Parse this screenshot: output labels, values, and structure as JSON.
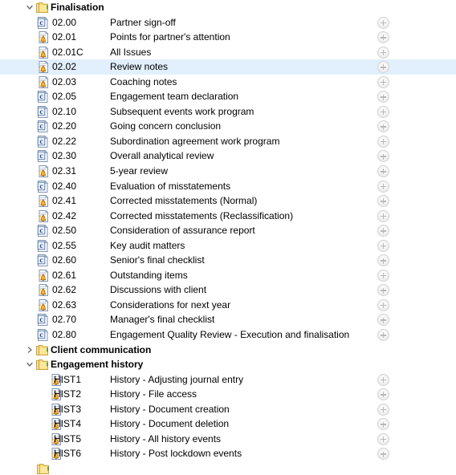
{
  "view": {
    "type": "file-tree",
    "selected_row_code": "02.02",
    "colors": {
      "selection": "#e2effc",
      "folder": "#ffd675",
      "doc_c_letter": "#1f4e9c",
      "doc_bell": "#f0a82a",
      "text": "#000000",
      "plus_button_border": "#d2d2d2"
    }
  },
  "rows": [
    {
      "kind": "folder",
      "indent": 1,
      "expanded": true,
      "label": "Finalisation"
    },
    {
      "kind": "file",
      "indent": 2,
      "icon": "document-c-icon",
      "code": "02.00",
      "desc": "Partner sign-off",
      "add": true
    },
    {
      "kind": "file",
      "indent": 2,
      "icon": "document-bell-icon",
      "code": "02.01",
      "desc": "Points for partner's attention",
      "add": true
    },
    {
      "kind": "file",
      "indent": 2,
      "icon": "document-bell-icon",
      "code": "02.01C",
      "desc": "All Issues",
      "add": true
    },
    {
      "kind": "file",
      "indent": 2,
      "icon": "document-bell-icon",
      "code": "02.02",
      "desc": "Review notes",
      "add": true,
      "selected": true
    },
    {
      "kind": "file",
      "indent": 2,
      "icon": "document-bell-icon",
      "code": "02.03",
      "desc": "Coaching notes",
      "add": true
    },
    {
      "kind": "file",
      "indent": 2,
      "icon": "document-c-icon",
      "code": "02.05",
      "desc": "Engagement team declaration",
      "add": true
    },
    {
      "kind": "file",
      "indent": 2,
      "icon": "document-c-icon",
      "code": "02.10",
      "desc": "Subsequent events work program",
      "add": true
    },
    {
      "kind": "file",
      "indent": 2,
      "icon": "document-c-icon",
      "code": "02.20",
      "desc": "Going concern conclusion",
      "add": true
    },
    {
      "kind": "file",
      "indent": 2,
      "icon": "document-c-icon",
      "code": "02.22",
      "desc": "Subordination agreement work program",
      "add": true
    },
    {
      "kind": "file",
      "indent": 2,
      "icon": "document-c-icon",
      "code": "02.30",
      "desc": "Overall analytical review",
      "add": true
    },
    {
      "kind": "file",
      "indent": 2,
      "icon": "document-bell-icon",
      "code": "02.31",
      "desc": "5-year review",
      "add": true
    },
    {
      "kind": "file",
      "indent": 2,
      "icon": "document-c-icon",
      "code": "02.40",
      "desc": "Evaluation of misstatements",
      "add": true
    },
    {
      "kind": "file",
      "indent": 2,
      "icon": "document-bell-icon",
      "code": "02.41",
      "desc": "Corrected misstatements (Normal)",
      "add": true
    },
    {
      "kind": "file",
      "indent": 2,
      "icon": "document-bell-icon",
      "code": "02.42",
      "desc": "Corrected misstatements (Reclassification)",
      "add": true
    },
    {
      "kind": "file",
      "indent": 2,
      "icon": "document-c-icon",
      "code": "02.50",
      "desc": "Consideration of assurance report",
      "add": true
    },
    {
      "kind": "file",
      "indent": 2,
      "icon": "document-c-icon",
      "code": "02.55",
      "desc": "Key audit matters",
      "add": true
    },
    {
      "kind": "file",
      "indent": 2,
      "icon": "document-c-icon",
      "code": "02.60",
      "desc": "Senior's final checklist",
      "add": true
    },
    {
      "kind": "file",
      "indent": 2,
      "icon": "document-bell-icon",
      "code": "02.61",
      "desc": "Outstanding items",
      "add": true
    },
    {
      "kind": "file",
      "indent": 2,
      "icon": "document-bell-icon",
      "code": "02.62",
      "desc": "Discussions with client",
      "add": true
    },
    {
      "kind": "file",
      "indent": 2,
      "icon": "document-bell-icon",
      "code": "02.63",
      "desc": "Considerations for next year",
      "add": true
    },
    {
      "kind": "file",
      "indent": 2,
      "icon": "document-c-icon",
      "code": "02.70",
      "desc": "Manager's final checklist",
      "add": true
    },
    {
      "kind": "file",
      "indent": 2,
      "icon": "document-c-icon",
      "code": "02.80",
      "desc": "Engagement Quality Review - Execution and finalisation",
      "add": true
    },
    {
      "kind": "folder",
      "indent": 1,
      "expanded": false,
      "label": "Client communication"
    },
    {
      "kind": "folder",
      "indent": 1,
      "expanded": true,
      "label": "Engagement history"
    },
    {
      "kind": "file",
      "indent": 3,
      "icon": "document-bell-icon",
      "code": "HIST1",
      "desc": "History - Adjusting journal entry",
      "add": true
    },
    {
      "kind": "file",
      "indent": 3,
      "icon": "document-bell-icon",
      "code": "HIST2",
      "desc": "History - File access",
      "add": true
    },
    {
      "kind": "file",
      "indent": 3,
      "icon": "document-bell-icon",
      "code": "HIST3",
      "desc": "History - Document creation",
      "add": true
    },
    {
      "kind": "file",
      "indent": 3,
      "icon": "document-bell-icon",
      "code": "HIST4",
      "desc": "History - Document deletion",
      "add": true
    },
    {
      "kind": "file",
      "indent": 3,
      "icon": "document-bell-icon",
      "code": "HIST5",
      "desc": "History - All history events",
      "add": true
    },
    {
      "kind": "file",
      "indent": 3,
      "icon": "document-bell-icon",
      "code": "HIST6",
      "desc": "History - Post lockdown events",
      "add": true
    }
  ]
}
